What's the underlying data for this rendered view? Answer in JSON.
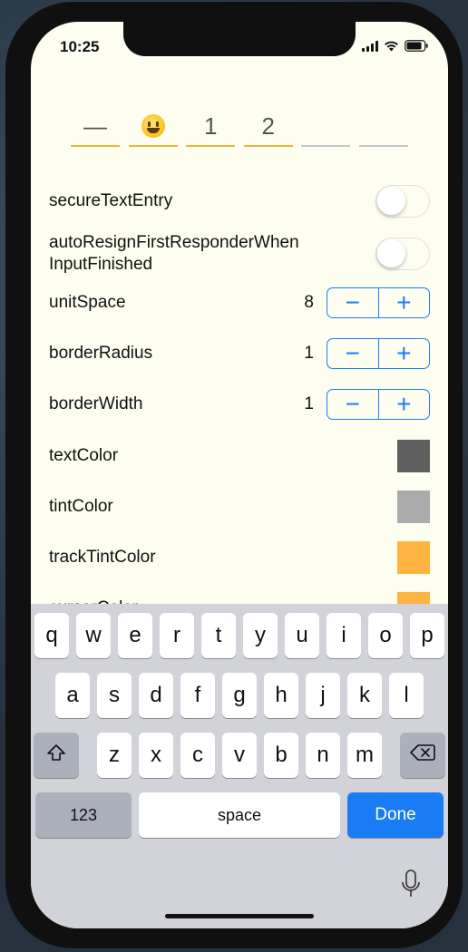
{
  "status_bar": {
    "time": "10:25"
  },
  "code_input": {
    "cells": [
      {
        "value": "—",
        "filled": true
      },
      {
        "value": "😀",
        "filled": true,
        "emoji": true
      },
      {
        "value": "1",
        "filled": true
      },
      {
        "value": "2",
        "filled": true
      },
      {
        "value": "",
        "filled": false
      },
      {
        "value": "",
        "filled": false
      }
    ]
  },
  "settings": {
    "secure_text_entry": {
      "label": "secureTextEntry",
      "on": false
    },
    "auto_resign": {
      "label_line1": "autoResignFirstResponderWhen",
      "label_line2": "InputFinished",
      "on": false
    },
    "unit_space": {
      "label": "unitSpace",
      "value": "8",
      "minus": "−",
      "plus": "+"
    },
    "border_radius": {
      "label": "borderRadius",
      "value": "1",
      "minus": "−",
      "plus": "+"
    },
    "border_width": {
      "label": "borderWidth",
      "value": "1",
      "minus": "−",
      "plus": "+"
    },
    "text_color": {
      "label": "textColor",
      "color": "#5f5f5f"
    },
    "tint_color": {
      "label": "tintColor",
      "color": "#ababab"
    },
    "track_tint_color": {
      "label": "trackTintColor",
      "color": "#ffb340"
    },
    "next_color": {
      "label": "cursorColor",
      "color": "#ffb340"
    }
  },
  "keyboard": {
    "row1": [
      "q",
      "w",
      "e",
      "r",
      "t",
      "y",
      "u",
      "i",
      "o",
      "p"
    ],
    "row2": [
      "a",
      "s",
      "d",
      "f",
      "g",
      "h",
      "j",
      "k",
      "l"
    ],
    "row3": [
      "z",
      "x",
      "c",
      "v",
      "b",
      "n",
      "m"
    ],
    "numbers_label": "123",
    "space_label": "space",
    "done_label": "Done"
  },
  "icons": {
    "shift": "shift-icon",
    "delete": "delete-icon",
    "mic": "microphone-icon",
    "wifi": "wifi-icon",
    "battery": "battery-icon",
    "signal": "signal-icon"
  }
}
